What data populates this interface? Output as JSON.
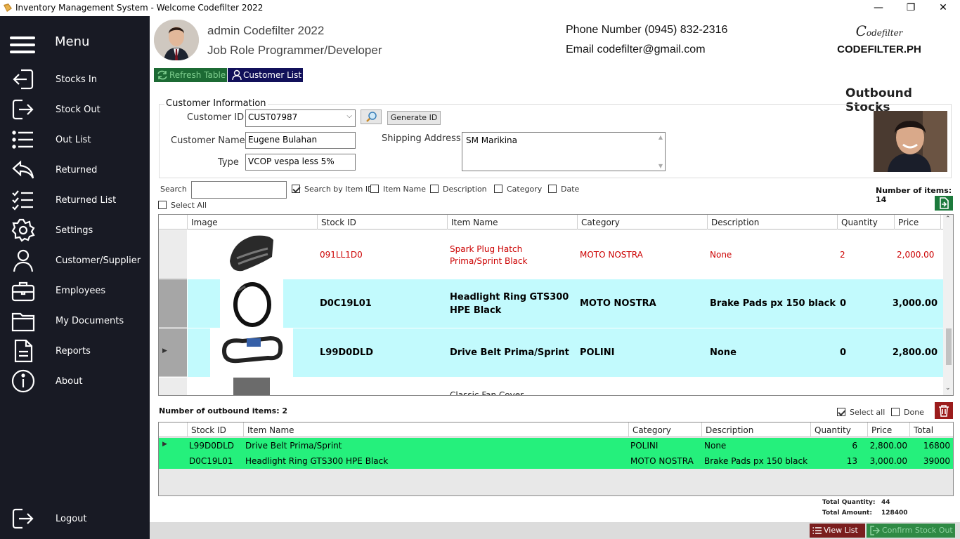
{
  "window": {
    "title": "Inventory Management System - Welcome Codefilter 2022"
  },
  "sidebar": {
    "menu_label": "Menu",
    "items": [
      {
        "label": "Stocks In",
        "icon": "arrow-in-icon"
      },
      {
        "label": "Stock Out",
        "icon": "arrow-out-icon"
      },
      {
        "label": "Out List",
        "icon": "list-icon"
      },
      {
        "label": "Returned",
        "icon": "return-icon"
      },
      {
        "label": "Returned List",
        "icon": "checklist-icon"
      },
      {
        "label": "Settings",
        "icon": "gear-icon"
      },
      {
        "label": "Customer/Supplier",
        "icon": "user-icon"
      },
      {
        "label": "Employees",
        "icon": "briefcase-icon"
      },
      {
        "label": "My Documents",
        "icon": "folder-icon"
      },
      {
        "label": "Reports",
        "icon": "document-icon"
      },
      {
        "label": "About",
        "icon": "info-icon"
      }
    ],
    "logout": "Logout"
  },
  "header": {
    "user_name": "admin Codefilter 2022",
    "job_role": "Job Role Programmer/Developer",
    "phone": "Phone Number (0945) 832-2316",
    "email": "Email codefilter@gmail.com",
    "brand_logo": "odefilter",
    "brand_name": "CODEFILTER.PH"
  },
  "toolbar": {
    "refresh": "Refresh Table",
    "customer_list": "Customer List"
  },
  "page_title": "Outbound Stocks",
  "customer": {
    "group_label": "Customer Information",
    "id_label": "Customer ID",
    "id_value": "CUST07987",
    "generate_label": "Generate ID",
    "name_label": "Customer Name",
    "name_value": "Eugene Bulahan",
    "type_label": "Type",
    "type_value": "VCOP vespa less 5%",
    "address_label": "Shipping Address",
    "address_value": "SM Marikina"
  },
  "search": {
    "label": "Search",
    "value": "",
    "by_item_id": "Search by Item ID",
    "item_name": "Item Name",
    "description": "Description",
    "category": "Category",
    "date": "Date",
    "select_all": "Select All",
    "count_label": "Number of items: 14"
  },
  "stock_grid": {
    "headers": [
      "Image",
      "Stock ID",
      "Item Name",
      "Category",
      "Description",
      "Quantity",
      "Price"
    ],
    "rows": [
      {
        "stock_id": "091LL1D0",
        "item_name": "Spark Plug Hatch Prima/Sprint Black",
        "category": "MOTO NOSTRA",
        "description": "None",
        "quantity": "2",
        "price": "2,000.00"
      },
      {
        "stock_id": "D0C19L01",
        "item_name": "Headlight Ring GTS300 HPE Black",
        "category": "MOTO NOSTRA",
        "description": "Brake Pads px 150 black",
        "quantity": "0",
        "price": "3,000.00"
      },
      {
        "stock_id": "L99D0DLD",
        "item_name": "Drive Belt Prima/Sprint",
        "category": "POLINI",
        "description": "None",
        "quantity": "0",
        "price": "2,800.00"
      },
      {
        "stock_id": "",
        "item_name": "Classic Fan Cover",
        "category": "",
        "description": "",
        "quantity": "",
        "price": ""
      }
    ]
  },
  "outbound": {
    "count_label": "Number of outbound items: 2",
    "select_all": "Select all",
    "done": "Done",
    "headers": [
      "Stock ID",
      "Item Name",
      "Category",
      "Description",
      "Quantity",
      "Price",
      "Total"
    ],
    "rows": [
      {
        "stock_id": "L99D0DLD",
        "item_name": "Drive Belt Prima/Sprint",
        "category": "POLINI",
        "description": "None",
        "quantity": "6",
        "price": "2,800.00",
        "total": "16800"
      },
      {
        "stock_id": "D0C19L01",
        "item_name": "Headlight Ring GTS300 HPE Black",
        "category": "MOTO NOSTRA",
        "description": "Brake Pads px 150 black",
        "quantity": "13",
        "price": "3,000.00",
        "total": "39000"
      }
    ],
    "total_quantity_label": "Total Quantity:",
    "total_quantity": "44",
    "total_amount_label": "Total Amount:",
    "total_amount": "128400"
  },
  "footer": {
    "view_list": "View List",
    "confirm": "Confirm Stock Out"
  },
  "colors": {
    "sidebar": "#181a24",
    "selected_row": "#c2fafd",
    "outbound_row": "#25f07c",
    "red_text": "#cc0000",
    "dark_red": "#9b1c1c"
  }
}
